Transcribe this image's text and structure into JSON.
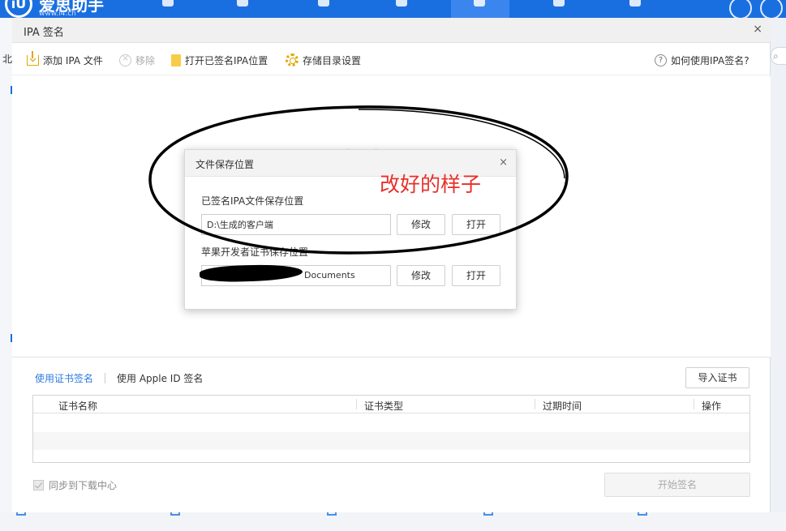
{
  "background": {
    "logo_text": "爱思助手",
    "logo_url": "www.i4.cn",
    "left_char": "北"
  },
  "window": {
    "title": "IPA 签名",
    "close_icon": "×"
  },
  "toolbar": {
    "add_label": "添加 IPA 文件",
    "remove_label": "移除",
    "open_signed_label": "打开已签名IPA位置",
    "storage_label": "存储目录设置",
    "help_label": "如何使用IPA签名?"
  },
  "cert_section": {
    "tabs": [
      {
        "label": "使用证书签名",
        "active": true
      },
      {
        "label": "使用 Apple ID 签名",
        "active": false
      }
    ],
    "import_label": "导入证书",
    "columns": [
      "证书名称",
      "证书类型",
      "过期时间",
      "操作"
    ],
    "sync_label": "同步到下载中心",
    "start_label": "开始签名"
  },
  "dialog": {
    "title": "文件保存位置",
    "close_icon": "×",
    "ipa_section_label": "已签名IPA文件保存位置",
    "ipa_path": "D:\\生成的客户端",
    "cert_section_label": "苹果开发者证书保存位置",
    "cert_path_visible": "Documents",
    "modify_label": "修改",
    "open_label": "打开"
  },
  "annotation": {
    "text": "改好的样子",
    "color": "#e8302a"
  },
  "colors": {
    "brand_blue": "#1a6fe0",
    "accent": "#2e7bde"
  }
}
